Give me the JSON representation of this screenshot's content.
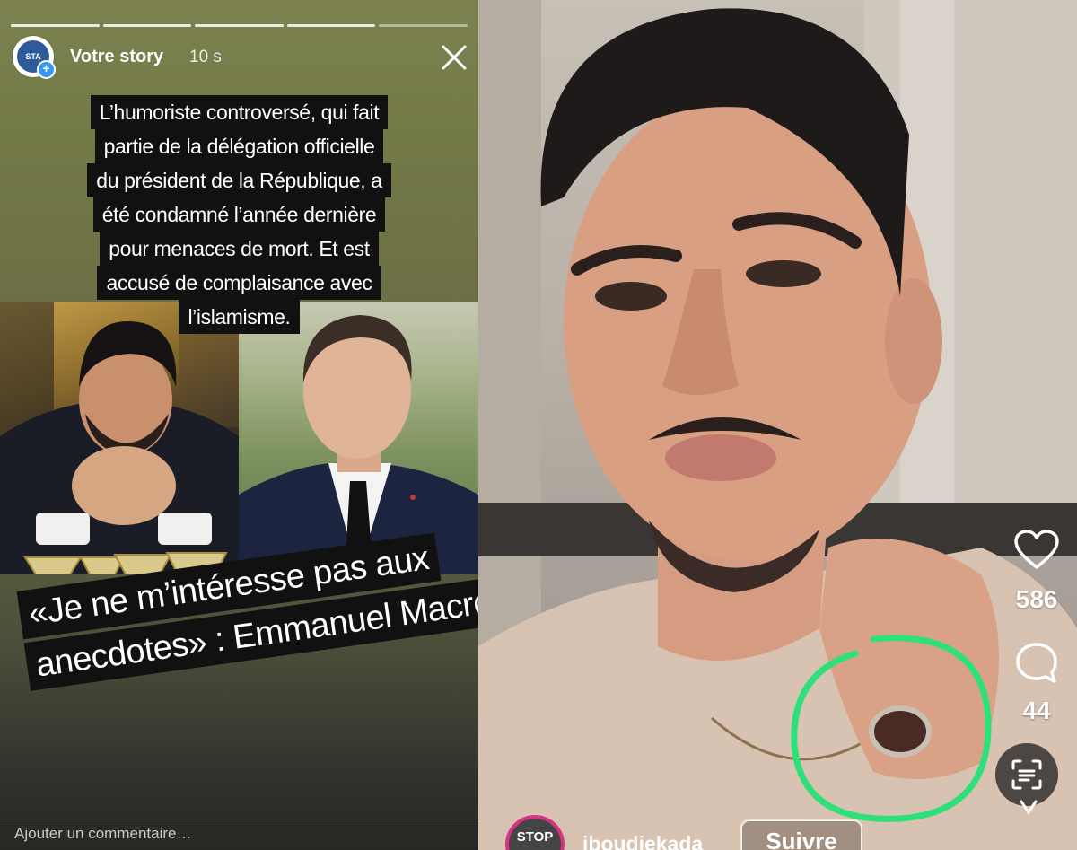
{
  "story": {
    "username": "Votre story",
    "time": "10 s",
    "avatar_text": "STA",
    "caption_lines": [
      "L’humoriste controversé, qui fait",
      "partie de la délégation officielle",
      "du président de la République, a",
      "été condamné l’année dernière",
      "pour menaces de mort. Et est",
      "accusé de complaisance avec",
      "l’islamisme."
    ],
    "quote_lines": [
      "«Je ne m’intéresse pas aux",
      "anecdotes» : Emmanuel Macron"
    ],
    "comment_placeholder": "Ajouter un commentaire…",
    "progress_segments": 5
  },
  "video": {
    "likes": "586",
    "comments": "44",
    "username": "iboudiekada",
    "follow_label": "Suivre",
    "avatar_text": "STOP"
  },
  "colors": {
    "highlight_circle": "#2ee07a",
    "story_bg_top": "#7c8150",
    "caption_bg": "#111111"
  },
  "icons": [
    "close-icon",
    "heart-icon",
    "comment-icon",
    "scan-icon",
    "chevron-down-icon"
  ]
}
